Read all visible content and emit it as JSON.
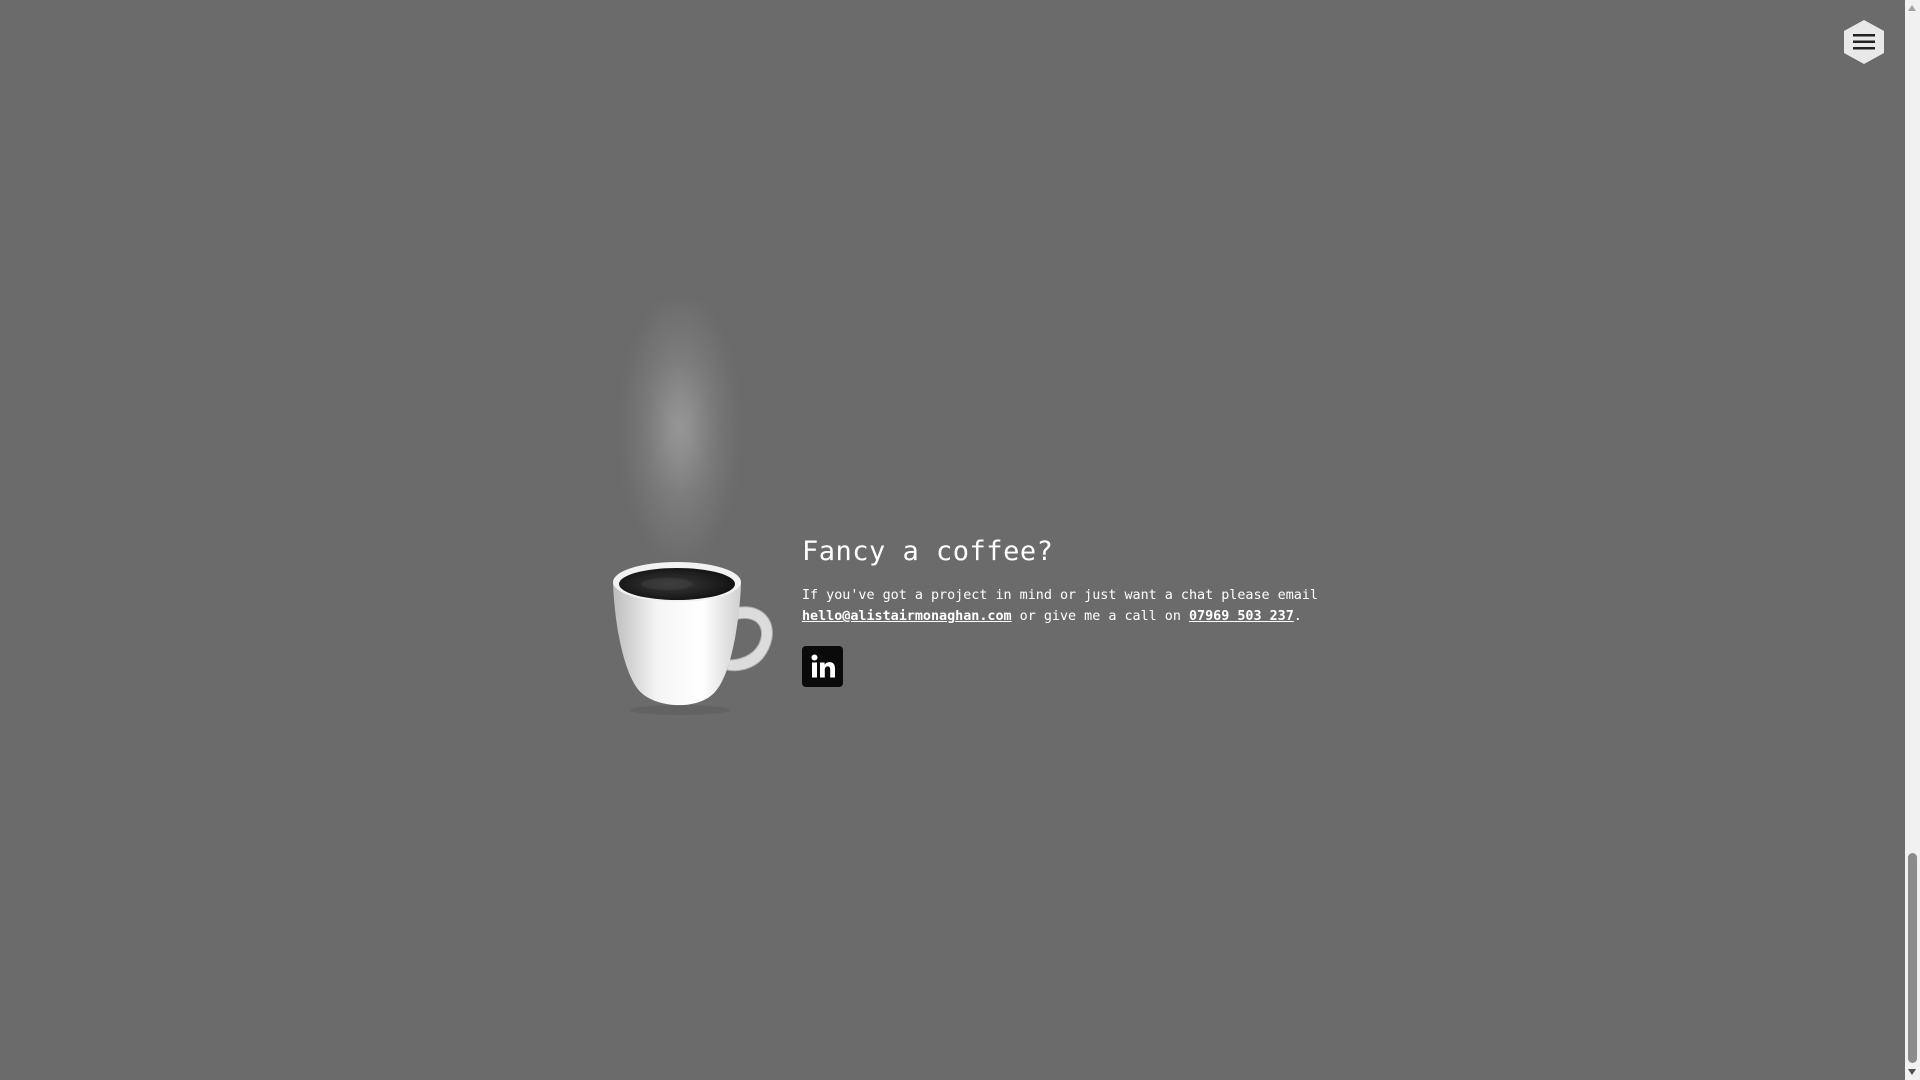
{
  "header": {
    "menu_icon": "hamburger-menu-icon"
  },
  "contact": {
    "heading": "Fancy a coffee?",
    "text_before_email": "If you've got a project in mind or just want a chat please email ",
    "email": "hello@alistairmonaghan.com",
    "text_middle": " or give me a call on ",
    "phone": "07969 503 237",
    "text_after": ".",
    "social": [
      {
        "name": "LinkedIn",
        "icon": "linkedin-icon"
      }
    ]
  },
  "illustration": {
    "icon": "coffee-cup-icon"
  },
  "colors": {
    "background": "#6b6b6b",
    "text": "#ffffff",
    "icon_bg": "#0a0a0a"
  }
}
